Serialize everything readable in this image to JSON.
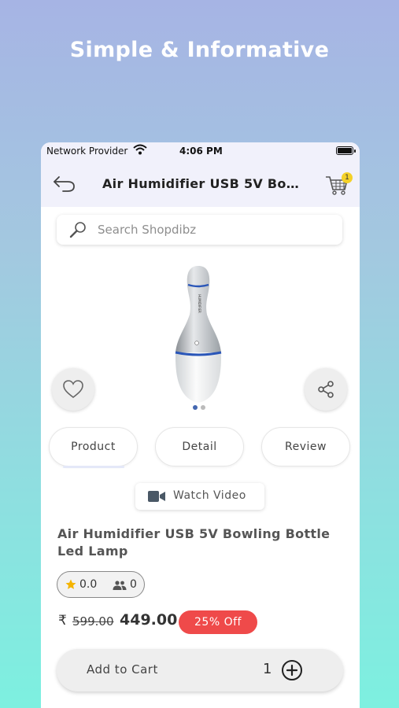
{
  "headline": "Simple & Informative",
  "status_bar": {
    "carrier": "Network Provider",
    "time": "4:06 PM"
  },
  "nav": {
    "title": "Air Humidifier USB 5V Bowling Bottle Led Lamp",
    "cart_count": "1"
  },
  "search": {
    "placeholder": "Search Shopdibz"
  },
  "tabs": [
    {
      "label": "Product"
    },
    {
      "label": "Detail"
    },
    {
      "label": "Review"
    }
  ],
  "video": {
    "label": "Watch Video"
  },
  "product": {
    "title": "Air Humidifier USB 5V Bowling Bottle Led Lamp",
    "rating": "0.0",
    "reviewers": "0",
    "currency": "₹",
    "old_price": "599.00",
    "price": "449.00",
    "discount": "25% Off"
  },
  "cart": {
    "add_label": "Add to Cart",
    "quantity": "1"
  },
  "colors": {
    "accent_blue": "#4467b0",
    "discount_red": "#ef4a4a",
    "badge_yellow": "#f4d128"
  }
}
